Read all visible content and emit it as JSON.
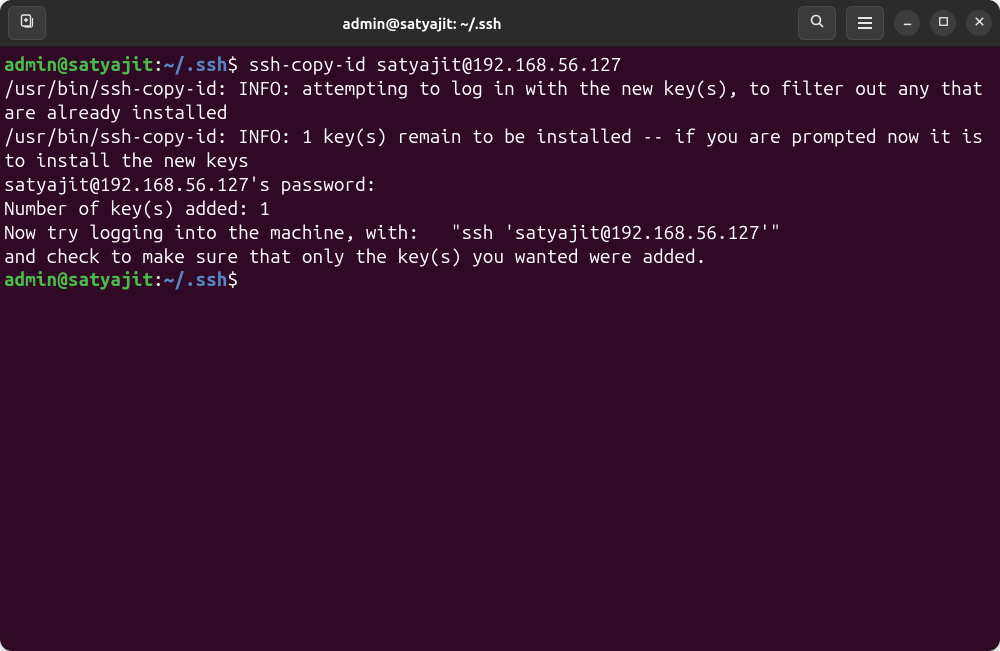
{
  "titlebar": {
    "title": "admin@satyajit: ~/.ssh"
  },
  "terminal": {
    "prompt1": {
      "userhost": "admin@satyajit",
      "colon": ":",
      "path": "~/.ssh",
      "dollar": "$",
      "command": " ssh-copy-id satyajit@192.168.56.127"
    },
    "output_lines": [
      "/usr/bin/ssh-copy-id: INFO: attempting to log in with the new key(s), to filter out any that are already installed",
      "/usr/bin/ssh-copy-id: INFO: 1 key(s) remain to be installed -- if you are prompted now it is to install the new keys",
      "satyajit@192.168.56.127's password:",
      "",
      "Number of key(s) added: 1",
      "",
      "Now try logging into the machine, with:   \"ssh 'satyajit@192.168.56.127'\"",
      "and check to make sure that only the key(s) you wanted were added.",
      ""
    ],
    "prompt2": {
      "userhost": "admin@satyajit",
      "colon": ":",
      "path": "~/.ssh",
      "dollar": "$"
    }
  }
}
